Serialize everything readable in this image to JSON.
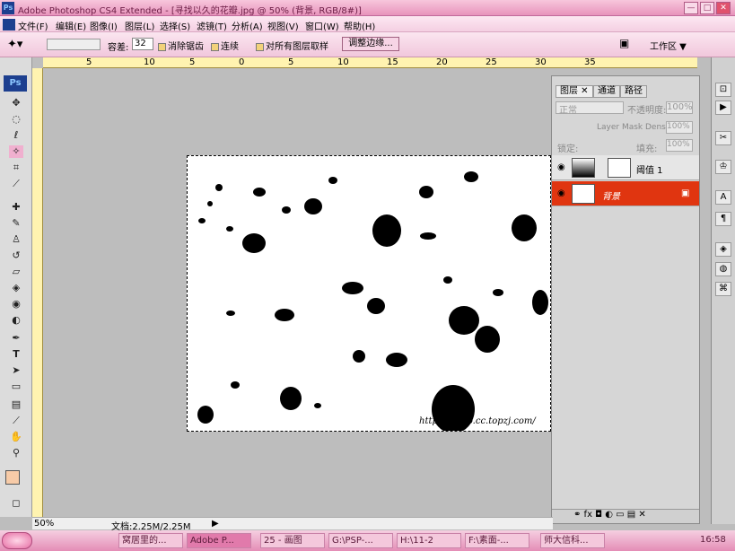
{
  "window": {
    "title": "Adobe Photoshop CS4 Extended - [寻找以久的花瓣.jpg @ 50% (背景, RGB/8#)]",
    "app_badge": "Ps",
    "minimize": "—",
    "maximize": "□",
    "close": "✕"
  },
  "menu": [
    "文件(F)",
    "编辑(E)",
    "图像(I)",
    "图层(L)",
    "选择(S)",
    "滤镜(T)",
    "分析(A)",
    "视图(V)",
    "窗口(W)",
    "帮助(H)"
  ],
  "options": {
    "tolerance_label": "容差:",
    "tolerance_value": "32",
    "antialias_label": "消除锯齿",
    "contiguous_label": "连续",
    "all_layers_label": "对所有图层取样",
    "refine_button": "调整边缘...",
    "workspace_label": "工作区 ▼"
  },
  "ruler_ticks": [
    "5",
    "10",
    "5",
    "0",
    "5",
    "10",
    "15",
    "20",
    "25",
    "30",
    "35"
  ],
  "panel": {
    "tabs": [
      "图层",
      "通道",
      "路径"
    ],
    "mode": "正常",
    "opacity_label": "不透明度:",
    "opacity_value": "100%",
    "mask_density_label": "Layer Mask Density",
    "mask_density_value": "100%",
    "lock_label": "锁定:",
    "fill_label": "填充:",
    "fill_value": "100%",
    "layers": [
      {
        "name": "阈值 1",
        "selected": false
      },
      {
        "name": "背景",
        "selected": true
      }
    ]
  },
  "status": {
    "zoom": "50%",
    "doc": "文档:2.25M/2.25M"
  },
  "watermark_text": "http://…guo.cc.topzj.com/",
  "taskbar": {
    "start": "",
    "items": [
      "窝居里的...",
      "Adobe P...",
      "25 - 画图",
      "G:\\PSP-...",
      "H:\\11-2",
      "F:\\素面-...",
      "师大信科..."
    ],
    "time": "16:58"
  }
}
